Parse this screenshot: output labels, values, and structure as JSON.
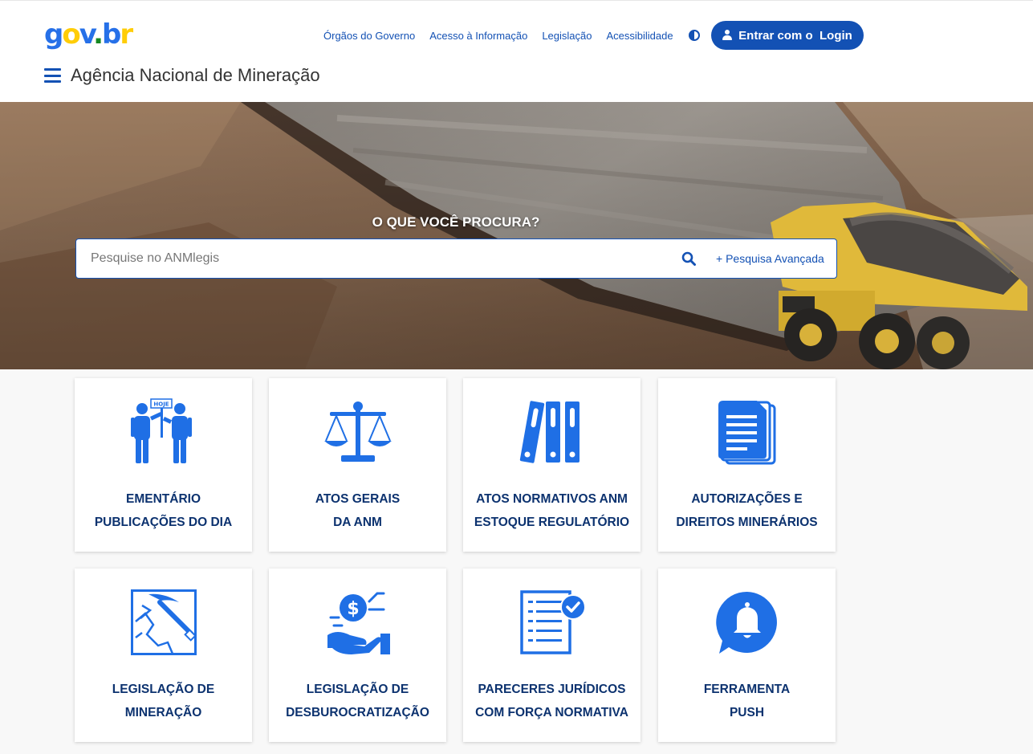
{
  "header": {
    "logo_text": "gov.br",
    "nav_links": [
      "Órgãos do Governo",
      "Acesso à Informação",
      "Legislação",
      "Acessibilidade"
    ],
    "login_button": "Entrar com o  Login",
    "site_title": "Agência Nacional de Mineração"
  },
  "hero": {
    "question": "O QUE VOCÊ PROCURA?",
    "search_placeholder": "Pesquise no ANMlegis",
    "advanced_search": "+ Pesquisa Avançada"
  },
  "cards": [
    {
      "line1": "EMENTÁRIO",
      "line2": "PUBLICAÇÕES DO DIA",
      "icon": "people-holding-today-sign-icon"
    },
    {
      "line1": "ATOS GERAIS",
      "line2": "DA ANM",
      "icon": "balance-scale-icon"
    },
    {
      "line1": "ATOS NORMATIVOS ANM",
      "line2": "ESTOQUE REGULATÓRIO",
      "icon": "binders-icon"
    },
    {
      "line1": "AUTORIZAÇÕES E",
      "line2": "DIREITOS MINERÁRIOS",
      "icon": "documents-icon"
    },
    {
      "line1": "LEGISLAÇÃO DE",
      "line2": "MINERAÇÃO",
      "icon": "pickaxe-icon"
    },
    {
      "line1": "LEGISLAÇÃO DE",
      "line2": "DESBUROCRATIZAÇÃO",
      "icon": "hand-coin-icon"
    },
    {
      "line1": "PARECERES JURÍDICOS",
      "line2": "COM FORÇA NORMATIVA",
      "icon": "checklist-icon"
    },
    {
      "line1": "FERRAMENTA",
      "line2": "PUSH",
      "icon": "bell-chat-icon"
    }
  ],
  "hoje_sign_text": "HOJE",
  "colors": {
    "primary": "#1351b4",
    "dark_blue": "#0c326f",
    "icon_blue": "#1f6fe5"
  }
}
